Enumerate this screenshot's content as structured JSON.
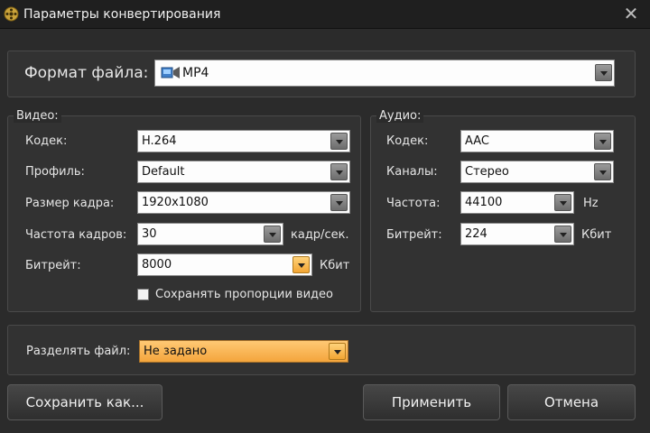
{
  "window": {
    "title": "Параметры конвертирования",
    "close_symbol": "✕"
  },
  "format": {
    "label": "Формат файла:",
    "value": "MP4"
  },
  "video": {
    "group_label": "Видео:",
    "codec": {
      "label": "Кодек:",
      "value": "H.264"
    },
    "profile": {
      "label": "Профиль:",
      "value": "Default"
    },
    "frame_size": {
      "label": "Размер кадра:",
      "value": "1920x1080"
    },
    "frame_rate": {
      "label": "Частота кадров:",
      "value": "30",
      "unit": "кадр/сек."
    },
    "bitrate": {
      "label": "Битрейт:",
      "value": "8000",
      "unit": "Кбит"
    },
    "keep_aspect": {
      "label": "Сохранять пропорции видео",
      "checked": false
    }
  },
  "audio": {
    "group_label": "Аудио:",
    "codec": {
      "label": "Кодек:",
      "value": "AAC"
    },
    "channels": {
      "label": "Каналы:",
      "value": "Стерео"
    },
    "frequency": {
      "label": "Частота:",
      "value": "44100",
      "unit": "Hz"
    },
    "bitrate": {
      "label": "Битрейт:",
      "value": "224",
      "unit": "Кбит"
    }
  },
  "split": {
    "label": "Разделять файл:",
    "value": "Не задано"
  },
  "buttons": {
    "save_as": "Сохранить как...",
    "apply": "Применить",
    "cancel": "Отмена"
  }
}
